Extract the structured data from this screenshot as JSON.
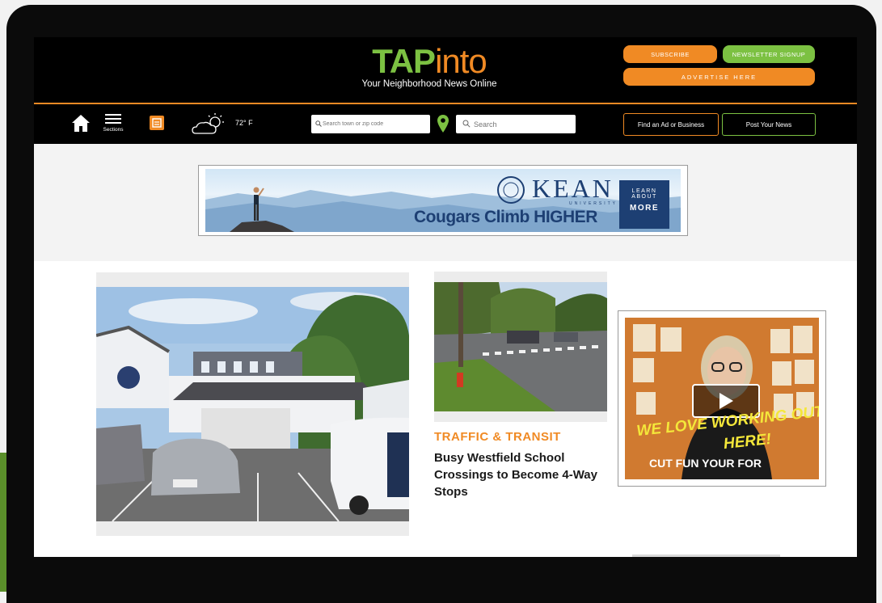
{
  "header": {
    "logo_tap": "TAP",
    "logo_into": "into",
    "tagline": "Your Neighborhood News Online",
    "subscribe_label": "SUBSCRIBE",
    "newsletter_label": "NEWSLETTER SIGNUP",
    "advertise_label": "ADVERTISE HERE"
  },
  "nav": {
    "sections_label": "Sections",
    "temperature": "72° F",
    "town_search_placeholder": "Search town or zip code",
    "search_placeholder": "Search",
    "find_ad_label": "Find an Ad or Business",
    "post_news_label": "Post Your News"
  },
  "ad": {
    "brand": "KEAN",
    "brand_sub": "UNIVERSITY",
    "slogan": "Cougars Climb HIGHER",
    "cta_line1": "LEARN",
    "cta_line2": "ABOUT",
    "cta_line3": "MORE"
  },
  "story": {
    "category": "TRAFFIC & TRANSIT",
    "headline": "Busy Westfield School Crossings to Become 4-Way Stops"
  },
  "video": {
    "line1": "WE LOVE WORKING OUT",
    "line2": "HERE!",
    "line3": "CUT FUN YOUR FOR"
  },
  "colors": {
    "brand_green": "#7cc142",
    "brand_orange": "#f08a24",
    "header_bg": "#000000",
    "kean_blue": "#1d3f73"
  },
  "icons": [
    "home-icon",
    "menu-icon",
    "rss-icon",
    "weather-icon",
    "search-icon",
    "map-pin-icon",
    "play-icon"
  ]
}
